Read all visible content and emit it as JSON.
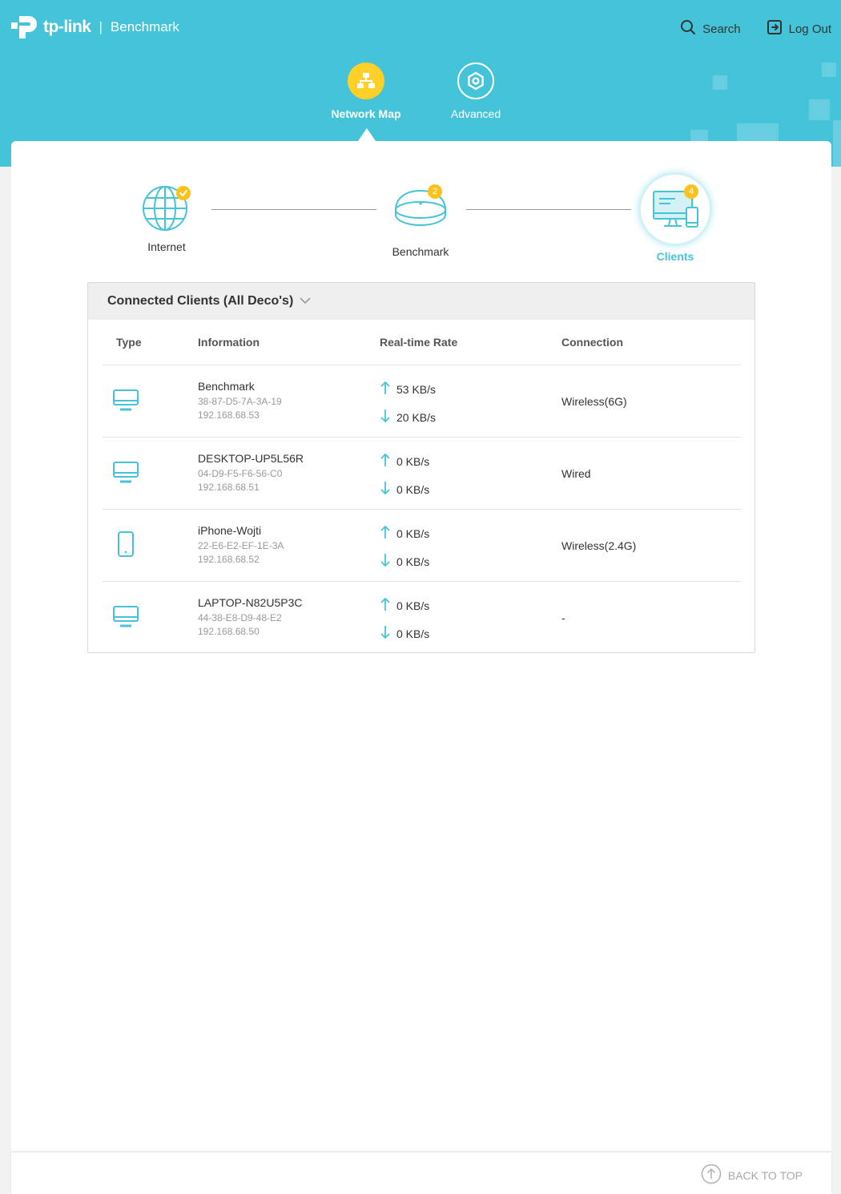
{
  "header": {
    "brand": "tp-link",
    "separator": "|",
    "device_name": "Benchmark",
    "search_label": "Search",
    "logout_label": "Log Out"
  },
  "nav": {
    "tabs": [
      {
        "label": "Network Map",
        "icon": "network-map-icon",
        "active": true
      },
      {
        "label": "Advanced",
        "icon": "advanced-gear-icon",
        "active": false
      }
    ]
  },
  "topology": {
    "internet": {
      "label": "Internet",
      "status": "connected-check"
    },
    "deco": {
      "label": "Benchmark",
      "count": "2"
    },
    "clients": {
      "label": "Clients",
      "count": "4"
    }
  },
  "clients_panel": {
    "title": "Connected Clients (All Deco's)",
    "columns": [
      "Type",
      "Information",
      "Real-time Rate",
      "Connection"
    ],
    "rows": [
      {
        "type": "desktop-icon",
        "name": "Benchmark",
        "mac": "38-87-D5-7A-3A-19",
        "ip": "192.168.68.53",
        "up": "53 KB/s",
        "down": "20 KB/s",
        "connection": "Wireless(6G)"
      },
      {
        "type": "desktop-icon",
        "name": "DESKTOP-UP5L56R",
        "mac": "04-D9-F5-F6-56-C0",
        "ip": "192.168.68.51",
        "up": "0 KB/s",
        "down": "0 KB/s",
        "connection": "Wired"
      },
      {
        "type": "phone-icon",
        "name": "iPhone-Wojti",
        "mac": "22-E6-E2-EF-1E-3A",
        "ip": "192.168.68.52",
        "up": "0 KB/s",
        "down": "0 KB/s",
        "connection": "Wireless(2.4G)"
      },
      {
        "type": "desktop-icon",
        "name": "LAPTOP-N82U5P3C",
        "mac": "44-38-E8-D9-48-E2",
        "ip": "192.168.68.50",
        "up": "0 KB/s",
        "down": "0 KB/s",
        "connection": "-"
      }
    ]
  },
  "footer": {
    "back_to_top": "BACK TO TOP"
  },
  "colors": {
    "accent": "#45c4d9",
    "highlight": "#ffd028",
    "badge": "#ffc21c"
  }
}
